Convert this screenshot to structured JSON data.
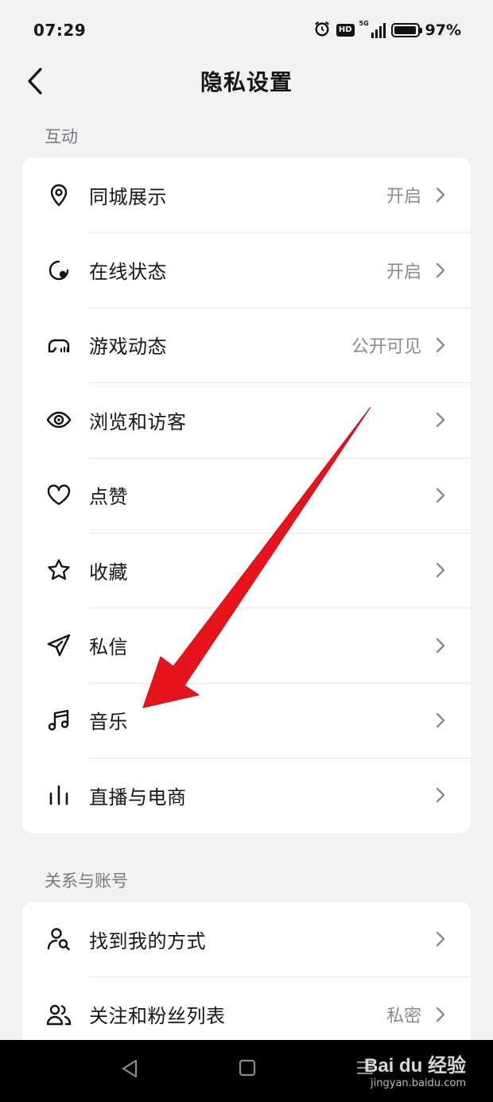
{
  "status_bar": {
    "time": "07:29",
    "hd": "HD",
    "network": "5G",
    "battery": "97%",
    "battery_level": 0.97
  },
  "header": {
    "title": "隐私设置"
  },
  "sections": [
    {
      "title": "互动",
      "items": [
        {
          "icon": "location-pin-icon",
          "label": "同城展示",
          "value": "开启"
        },
        {
          "icon": "online-status-icon",
          "label": "在线状态",
          "value": "开启"
        },
        {
          "icon": "gamepad-icon",
          "label": "游戏动态",
          "value": "公开可见"
        },
        {
          "icon": "eye-icon",
          "label": "浏览和访客",
          "value": ""
        },
        {
          "icon": "heart-icon",
          "label": "点赞",
          "value": ""
        },
        {
          "icon": "star-icon",
          "label": "收藏",
          "value": ""
        },
        {
          "icon": "send-icon",
          "label": "私信",
          "value": ""
        },
        {
          "icon": "music-note-icon",
          "label": "音乐",
          "value": ""
        },
        {
          "icon": "live-bars-icon",
          "label": "直播与电商",
          "value": ""
        }
      ]
    },
    {
      "title": "关系与账号",
      "items": [
        {
          "icon": "user-search-icon",
          "label": "找到我的方式",
          "value": ""
        },
        {
          "icon": "users-icon",
          "label": "关注和粉丝列表",
          "value": "私密"
        }
      ]
    }
  ],
  "watermark": {
    "main": "Bai du 经验",
    "sub": "jingyan.baidu.com"
  },
  "colors": {
    "background": "#f2f2f4",
    "card": "#ffffff",
    "arrow": "#e8141b"
  }
}
